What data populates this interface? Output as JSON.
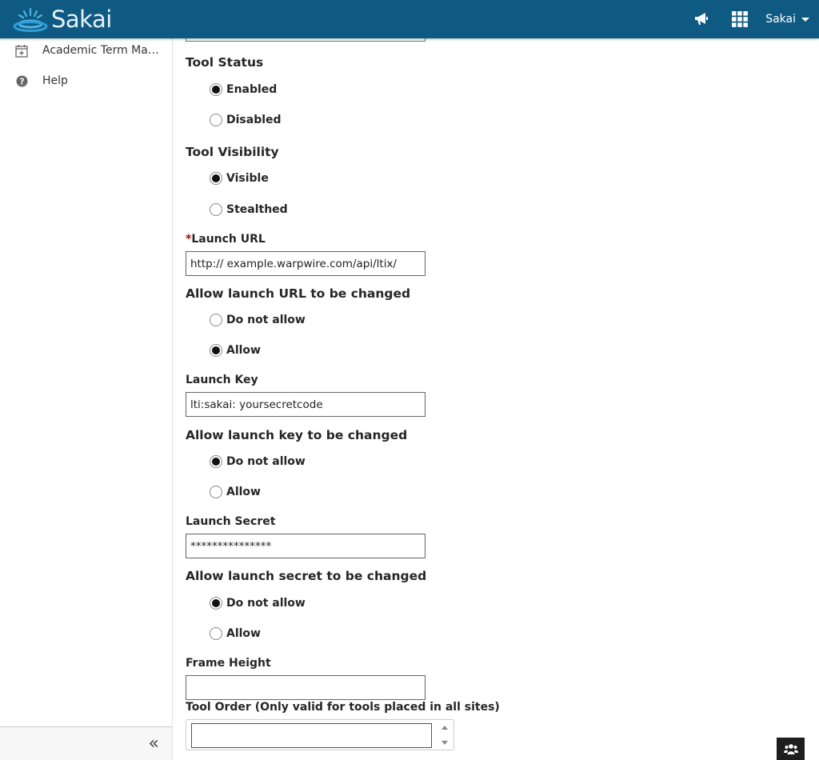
{
  "header": {
    "logo_text": "Sakai",
    "brand_color": "#0f5a82",
    "notifications_icon": "bullhorn-icon",
    "apps_icon": "grid-icon",
    "user_menu_label": "Sakai"
  },
  "sidebar": {
    "items": [
      {
        "label": "Academic Term Man...",
        "icon": "calendar-plus-icon"
      },
      {
        "label": "Help",
        "icon": "question-circle-icon"
      }
    ],
    "collapse_label": "«"
  },
  "form": {
    "tool_status": {
      "title": "Tool Status",
      "options": [
        {
          "label": "Enabled",
          "checked": true
        },
        {
          "label": "Disabled",
          "checked": false
        }
      ]
    },
    "tool_visibility": {
      "title": "Tool Visibility",
      "options": [
        {
          "label": "Visible",
          "checked": true
        },
        {
          "label": "Stealthed",
          "checked": false
        }
      ]
    },
    "launch_url": {
      "required_mark": "*",
      "label": "Launch URL",
      "value": "http:// example.warpwire.com/api/ltix/"
    },
    "allow_url_change": {
      "title": "Allow launch URL to be changed",
      "options": [
        {
          "label": "Do not allow",
          "checked": false
        },
        {
          "label": "Allow",
          "checked": true
        }
      ]
    },
    "launch_key": {
      "label": "Launch Key",
      "value": "lti:sakai: yoursecretcode"
    },
    "allow_key_change": {
      "title": "Allow launch key to be changed",
      "options": [
        {
          "label": "Do not allow",
          "checked": true
        },
        {
          "label": "Allow",
          "checked": false
        }
      ]
    },
    "launch_secret": {
      "label": "Launch Secret",
      "value": "***************"
    },
    "allow_secret_change": {
      "title": "Allow launch secret to be changed",
      "options": [
        {
          "label": "Do not allow",
          "checked": true
        },
        {
          "label": "Allow",
          "checked": false
        }
      ]
    },
    "frame_height": {
      "label": "Frame Height",
      "value": ""
    },
    "tool_order": {
      "label": "Tool Order (Only valid for tools placed in all sites)",
      "value": ""
    }
  },
  "roster_button_icon": "users-icon"
}
